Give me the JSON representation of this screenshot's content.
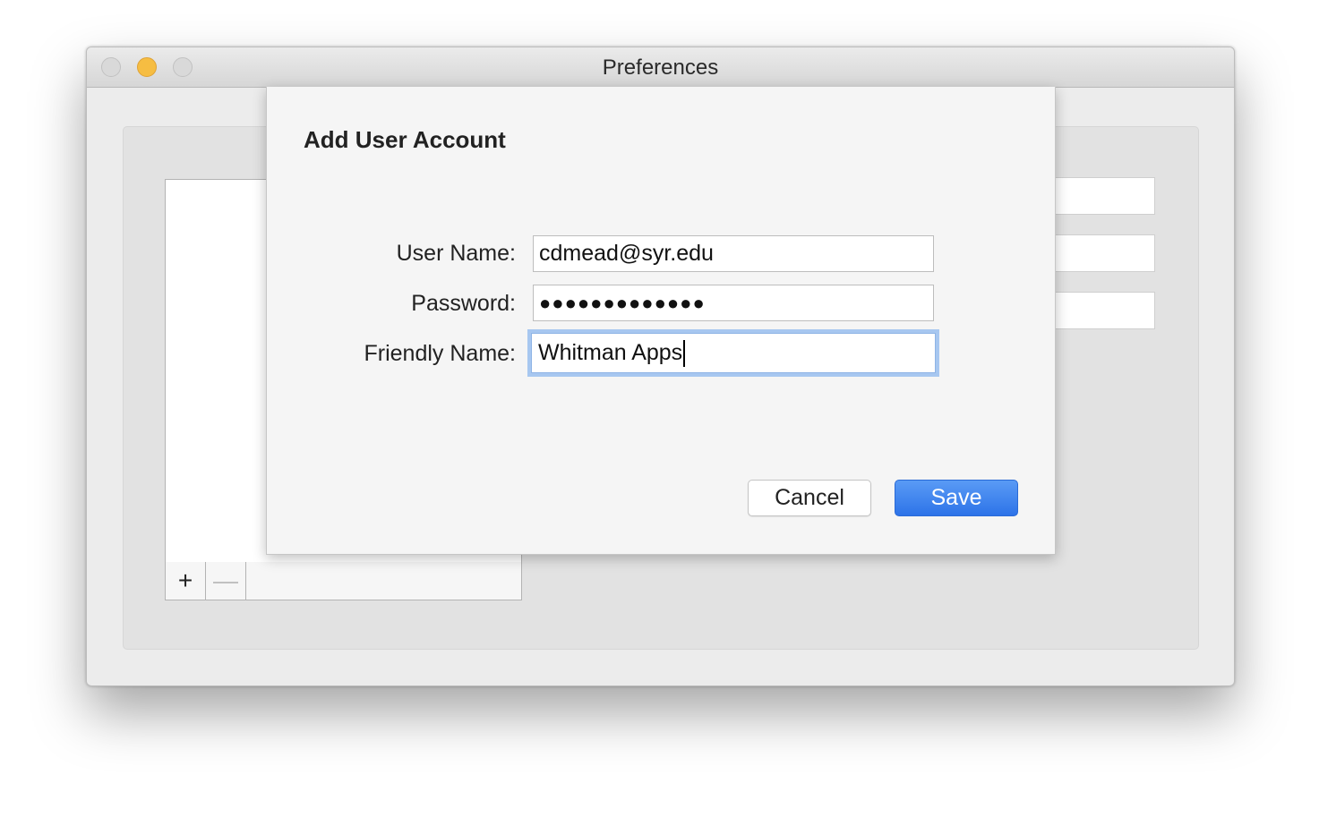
{
  "window": {
    "title": "Preferences"
  },
  "list": {
    "add_button": "+",
    "remove_button": "—"
  },
  "sheet": {
    "title": "Add User Account",
    "fields": {
      "user_name": {
        "label": "User Name:",
        "value": "cdmead@syr.edu"
      },
      "password": {
        "label": "Password:",
        "value": "●●●●●●●●●●●●●"
      },
      "friendly_name": {
        "label": "Friendly Name:",
        "value": "Whitman Apps"
      }
    },
    "cancel_label": "Cancel",
    "save_label": "Save"
  },
  "colors": {
    "accent": "#2d73e8",
    "focus_ring": "#a7c7f0",
    "minimize": "#f6bd42"
  }
}
